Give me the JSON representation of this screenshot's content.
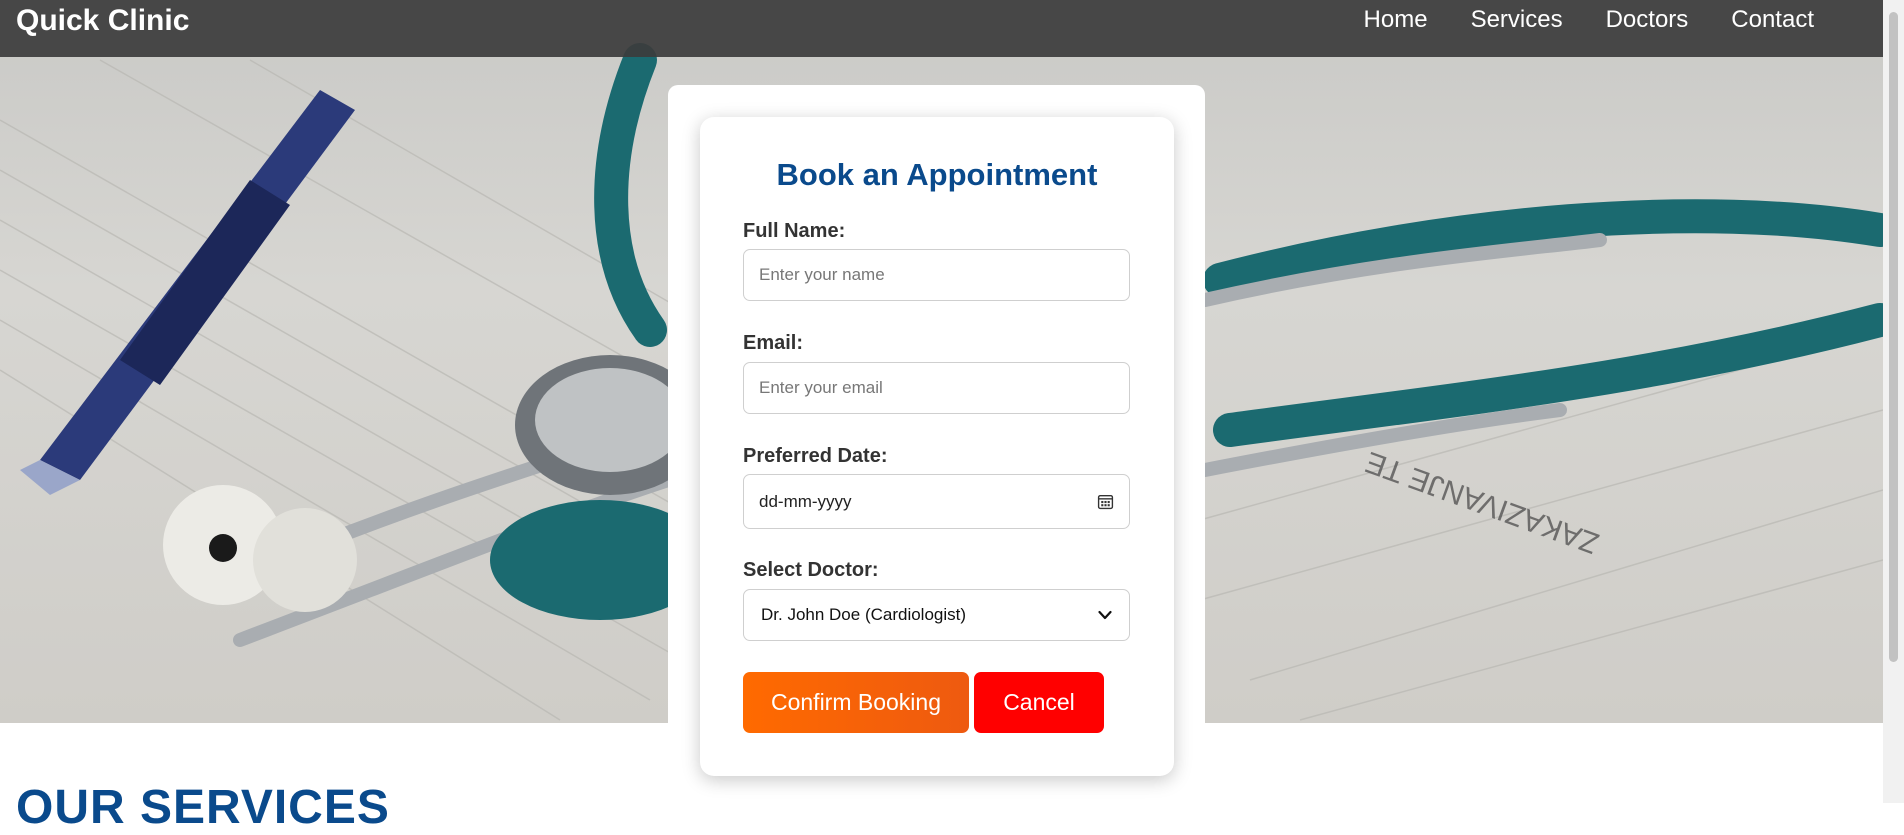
{
  "header": {
    "brand": "Quick Clinic",
    "nav": [
      "Home",
      "Services",
      "Doctors",
      "Contact"
    ]
  },
  "form": {
    "title": "Book an Appointment",
    "name_label": "Full Name:",
    "name_placeholder": "Enter your name",
    "email_label": "Email:",
    "email_placeholder": "Enter your email",
    "date_label": "Preferred Date:",
    "date_value": "dd-mm-yyyy",
    "doctor_label": "Select Doctor:",
    "doctor_selected": "Dr. John Doe (Cardiologist)",
    "confirm_label": "Confirm Booking",
    "cancel_label": "Cancel"
  },
  "services": {
    "heading": "OUR SERVICES"
  },
  "colors": {
    "brand_blue": "#0a4a8c",
    "confirm_orange": "#ff6a00",
    "cancel_red": "#ff0000",
    "nav_bg": "#3c3c3c"
  },
  "icons": [
    "calendar-icon",
    "chevron-down-icon"
  ]
}
